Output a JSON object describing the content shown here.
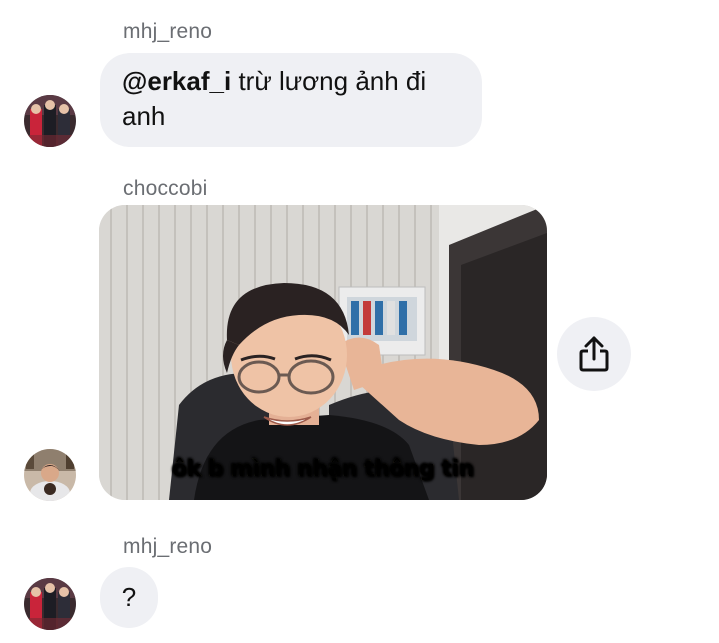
{
  "messages": [
    {
      "sender": "mhj_reno",
      "mention": "@erkaf_i",
      "text": "trừ lương ảnh đi anh"
    },
    {
      "sender": "choccobi",
      "caption": "ôk b mình nhận thông tin",
      "share_icon": "share-icon"
    },
    {
      "sender": "mhj_reno",
      "text": "?"
    }
  ],
  "colors": {
    "bubble": "#eff0f4",
    "sender": "#6b6e73"
  }
}
